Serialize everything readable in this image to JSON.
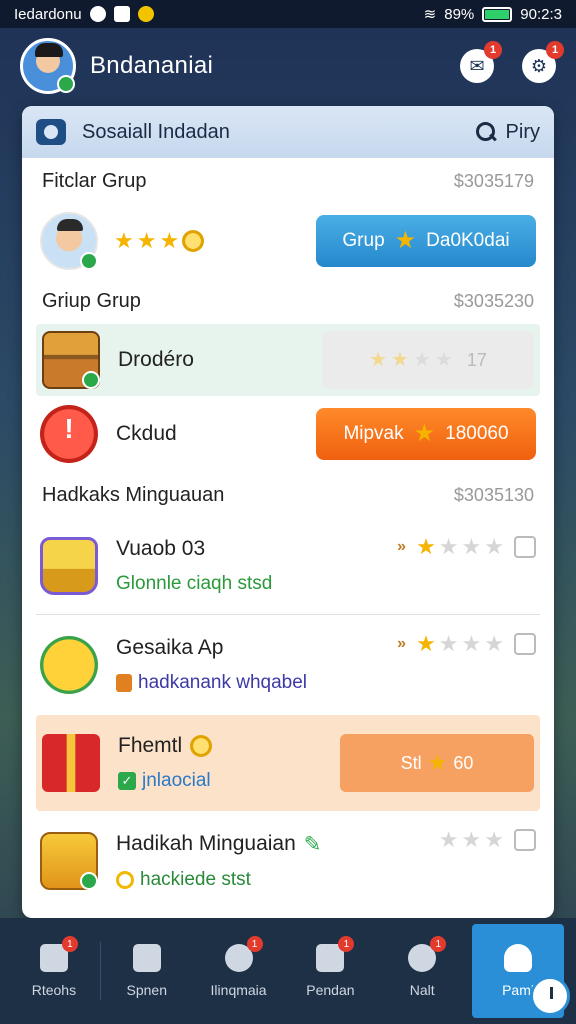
{
  "status_bar": {
    "carrier": "Iedardonu",
    "battery_pct": "89%",
    "time": "90:2:3"
  },
  "header": {
    "title": "Bndananiai",
    "notif_badge": "1",
    "settings_badge": "1"
  },
  "panel": {
    "title": "Sosaiall Indadan",
    "search_label": "Piry",
    "sections": [
      {
        "title": "Fitclar Grup",
        "value": "$3035179"
      },
      {
        "title": "Griup Grup",
        "value": "$3035230"
      },
      {
        "title": "Hadkaks Minguauan",
        "value": "$3035130"
      }
    ],
    "rows": {
      "r1": {
        "button_left": "Grup",
        "button_right": "Da0K0dai"
      },
      "r2": {
        "label": "Drodéro",
        "faded_value": "17"
      },
      "r3": {
        "label": "Ckdud",
        "button_left": "Mipvak",
        "button_right": "180060"
      },
      "r4": {
        "title": "Vuaob 03",
        "sub": "Glonnle ciaqh stsd"
      },
      "r5": {
        "title": "Gesaika Ap",
        "sub": "hadkanank whqabel"
      },
      "r6": {
        "title": "Fhemtl",
        "sub": "jnlaocial",
        "button_left": "Stl",
        "button_right": "60"
      },
      "r7": {
        "title": "Hadikah Minguaian",
        "sub": "hackiede stst"
      }
    }
  },
  "nav": {
    "items": [
      {
        "label": "Rteohs",
        "badge": "1"
      },
      {
        "label": "Spnen",
        "badge": ""
      },
      {
        "label": "Ilinqmaia",
        "badge": "1"
      },
      {
        "label": "Pendan",
        "badge": "1"
      },
      {
        "label": "Nalt",
        "badge": "1"
      },
      {
        "label": "Paml",
        "badge": ""
      }
    ]
  },
  "colors": {
    "primary_blue": "#2588cc",
    "orange": "#f0600e",
    "star": "#f5b400"
  }
}
